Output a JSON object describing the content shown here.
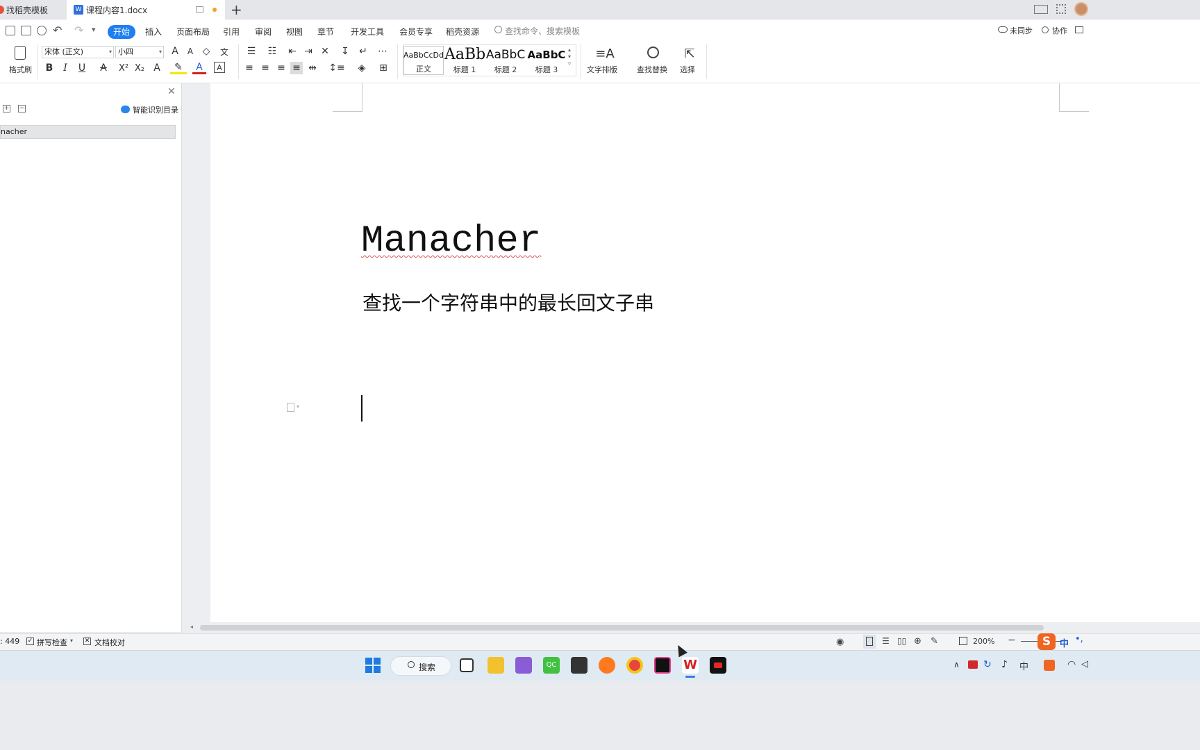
{
  "tabs": [
    {
      "label": "找稻壳模板"
    },
    {
      "label": "课程内容1.docx"
    }
  ],
  "menu": {
    "items": [
      "开始",
      "插入",
      "页面布局",
      "引用",
      "审阅",
      "视图",
      "章节",
      "开发工具",
      "会员专享",
      "稻壳资源"
    ],
    "search_placeholder": "查找命令、搜索模板",
    "sync": "未同步",
    "collab": "协作"
  },
  "ribbon": {
    "format_painter": "格式刷",
    "font_name": "宋体 (正文)",
    "font_size": "小四",
    "styles": [
      {
        "sample": "AaBbCcDd",
        "name": "正文"
      },
      {
        "sample": "AaBb",
        "name": "标题 1"
      },
      {
        "sample": "AaBbC",
        "name": "标题 2"
      },
      {
        "sample": "AaBbC",
        "name": "标题 3"
      }
    ],
    "text_layout": "文字排版",
    "find_replace": "查找替换",
    "select": "选择"
  },
  "nav": {
    "smart_toc": "智能识别目录",
    "items": [
      "nacher"
    ]
  },
  "document": {
    "title": "Manacher",
    "subtitle": "查找一个字符串中的最长回文子串"
  },
  "status": {
    "word_count": ": 449",
    "spell_check": "拼写检查",
    "doc_proof": "文档校对",
    "zoom": "200%"
  },
  "taskbar": {
    "search": "搜索",
    "ime": "中"
  },
  "colors": {
    "accent": "#1e7ff0",
    "taskbar": "#dfeaf3"
  }
}
